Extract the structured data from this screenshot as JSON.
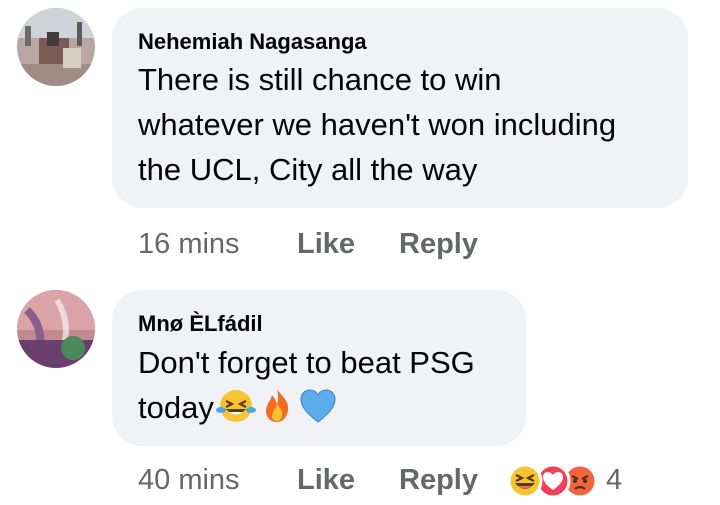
{
  "comments": [
    {
      "author": "Nehemiah Nagasanga",
      "lines": [
        "There is still chance to win",
        "whatever we haven't won including",
        "the UCL,  City all the way"
      ],
      "time": "16 mins",
      "like_label": "Like",
      "reply_label": "Reply"
    },
    {
      "author": "Mnø ÈLfádil",
      "lines": [
        "Don't forget to beat PSG",
        "today"
      ],
      "emojis": [
        "laughing-crying-emoji",
        "fire-emoji",
        "blue-heart-emoji"
      ],
      "time": "40 mins",
      "like_label": "Like",
      "reply_label": "Reply",
      "reactions": [
        "haha-reaction-icon",
        "love-reaction-icon",
        "angry-reaction-icon"
      ],
      "reaction_count": "4"
    }
  ],
  "colors": {
    "bubble": "#f0f2f5",
    "text": "#050505",
    "meta": "#65676b"
  }
}
